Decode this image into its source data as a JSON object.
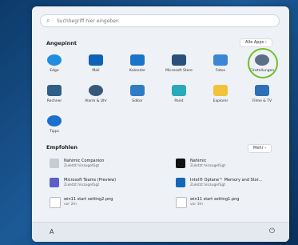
{
  "search": {
    "placeholder": "Suchbegriff hier eingeben",
    "icon": "search-icon"
  },
  "pinned": {
    "title": "Angepinnt",
    "all_apps": "Alle Apps  ›"
  },
  "apps": [
    {
      "label": "Edge",
      "icon": "edge-icon",
      "color": "#1f8de0"
    },
    {
      "label": "Mail",
      "icon": "mail-icon",
      "color": "#0e63b8"
    },
    {
      "label": "Kalender",
      "icon": "calendar-icon",
      "color": "#1a74c9"
    },
    {
      "label": "Microsoft Store",
      "icon": "store-icon",
      "color": "#2a4f7a"
    },
    {
      "label": "Fotos",
      "icon": "photos-icon",
      "color": "#3b86d6"
    },
    {
      "label": "Einstellungen",
      "icon": "gear-icon",
      "color": "#5b6f84"
    },
    {
      "label": "Rechner",
      "icon": "calculator-icon",
      "color": "#2f5e86"
    },
    {
      "label": "Alarm & Uhr",
      "icon": "clock-icon",
      "color": "#36597a"
    },
    {
      "label": "Editor",
      "icon": "notepad-icon",
      "color": "#2f7cc4"
    },
    {
      "label": "Paint",
      "icon": "paint-icon",
      "color": "#2aa9b9"
    },
    {
      "label": "Explorer",
      "icon": "folder-icon",
      "color": "#f2c23a"
    },
    {
      "label": "Filme & TV",
      "icon": "film-icon",
      "color": "#2f6fb6"
    },
    {
      "label": "Tipps",
      "icon": "tips-icon",
      "color": "#1a6fcf"
    }
  ],
  "recommended": {
    "title": "Empfohlen",
    "more": "Mehr  ›",
    "items": [
      {
        "name": "Nahimic Companion",
        "sub": "Zuletzt hinzugefügt",
        "icon": "nahimic-companion-icon",
        "color": "#c7cbd2"
      },
      {
        "name": "Nahimic",
        "sub": "Zuletzt hinzugefügt",
        "icon": "nahimic-icon",
        "color": "#111111"
      },
      {
        "name": "Microsoft Teams (Preview)",
        "sub": "Zuletzt hinzugefügt",
        "icon": "teams-icon",
        "color": "#5b5fc7"
      },
      {
        "name": "Intel® Optane™ Memory and Stor...",
        "sub": "Zuletzt hinzugefügt",
        "icon": "intel-icon",
        "color": "#1566b8"
      },
      {
        "name": "win11 start setting2.png",
        "sub": "vor 2m",
        "icon": "image-file-icon",
        "color": "#ffffff"
      },
      {
        "name": "win11 start setting1.png",
        "sub": "vor 3m",
        "icon": "image-file-icon",
        "color": "#ffffff"
      }
    ]
  },
  "bottom": {
    "user_icon": "user-icon",
    "power_icon": "power-icon",
    "user_glyph": "A",
    "power_glyph": "⏻"
  }
}
